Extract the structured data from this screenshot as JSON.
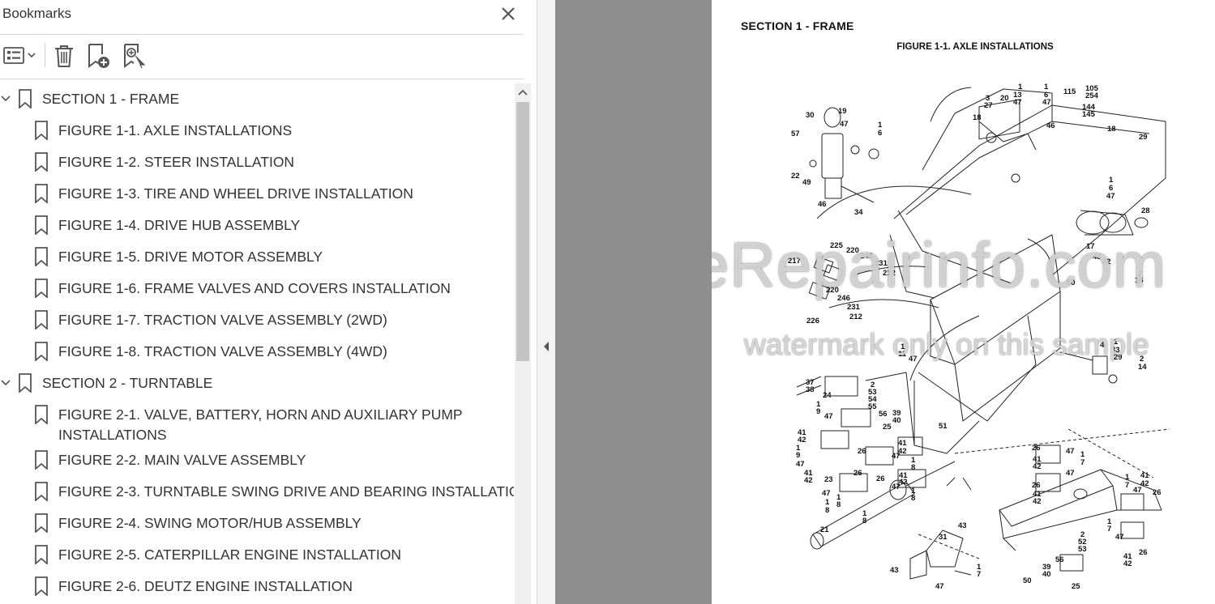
{
  "bookmarks_panel": {
    "title": "Bookmarks",
    "close_icon": "close-icon",
    "toolbar": {
      "options_icon": "list-options-icon",
      "delete_icon": "trash-icon",
      "new_bookmark_icon": "add-bookmark-icon",
      "find_bookmark_icon": "find-current-bookmark-icon"
    },
    "items": [
      {
        "label": "SECTION 1 - FRAME",
        "level": 0,
        "expanded": true
      },
      {
        "label": "FIGURE 1-1. AXLE INSTALLATIONS",
        "level": 1
      },
      {
        "label": "FIGURE 1-2. STEER INSTALLATION",
        "level": 1
      },
      {
        "label": "FIGURE 1-3. TIRE AND WHEEL DRIVE INSTALLATION",
        "level": 1
      },
      {
        "label": "FIGURE 1-4. DRIVE HUB ASSEMBLY",
        "level": 1
      },
      {
        "label": "FIGURE 1-5. DRIVE MOTOR ASSEMBLY",
        "level": 1
      },
      {
        "label": "FIGURE 1-6. FRAME VALVES AND COVERS INSTALLATION",
        "level": 1
      },
      {
        "label": "FIGURE 1-7. TRACTION VALVE ASSEMBLY (2WD)",
        "level": 1
      },
      {
        "label": "FIGURE 1-8. TRACTION VALVE ASSEMBLY (4WD)",
        "level": 1
      },
      {
        "label": "SECTION 2 - TURNTABLE",
        "level": 0,
        "expanded": true
      },
      {
        "label": "FIGURE 2-1. VALVE, BATTERY, HORN AND AUXILIARY PUMP INSTALLATIONS",
        "level": 1
      },
      {
        "label": "FIGURE 2-2. MAIN VALVE ASSEMBLY",
        "level": 1
      },
      {
        "label": "FIGURE 2-3. TURNTABLE SWING DRIVE AND BEARING INSTALLATION",
        "level": 1
      },
      {
        "label": "FIGURE 2-4. SWING MOTOR/HUB ASSEMBLY",
        "level": 1
      },
      {
        "label": "FIGURE 2-5. CATERPILLAR ENGINE INSTALLATION",
        "level": 1
      },
      {
        "label": "FIGURE 2-6. DEUTZ ENGINE INSTALLATION",
        "level": 1
      }
    ]
  },
  "document": {
    "section_title": "SECTION 1 - FRAME",
    "figure_title": "FIGURE 1-1. AXLE INSTALLATIONS",
    "watermark_main": "eRepairinfo.com",
    "watermark_sub": "watermark only on this sample",
    "callouts": [
      "1",
      "13",
      "47",
      "1",
      "6",
      "47",
      "115",
      "105",
      "254",
      "3",
      "27",
      "20",
      "144",
      "145",
      "30",
      "19",
      "47",
      "1",
      "6",
      "18",
      "46",
      "18",
      "29",
      "57",
      "22",
      "49",
      "46",
      "34",
      "1",
      "6",
      "47",
      "28",
      "17",
      "48",
      "32",
      "2",
      "16",
      "225",
      "220",
      "246",
      "217",
      "231",
      "212",
      "220",
      "246",
      "231",
      "212",
      "226",
      "50",
      "1",
      "11",
      "47",
      "4",
      "1",
      "33",
      "29",
      "2",
      "14",
      "37",
      "38",
      "24",
      "2",
      "53",
      "54",
      "55",
      "1",
      "9",
      "47",
      "56",
      "39",
      "40",
      "25",
      "51",
      "41",
      "42",
      "1",
      "9",
      "26",
      "41",
      "42",
      "47",
      "1",
      "8",
      "41",
      "42",
      "26",
      "47",
      "41",
      "42",
      "23",
      "1",
      "8",
      "47",
      "1",
      "8",
      "26",
      "47",
      "41",
      "42",
      "47",
      "1",
      "7",
      "1",
      "7",
      "47",
      "41",
      "42",
      "26",
      "26",
      "41",
      "42",
      "21",
      "1",
      "8",
      "31",
      "43",
      "2",
      "52",
      "53",
      "1",
      "7",
      "47",
      "56",
      "39",
      "40",
      "25",
      "43",
      "47",
      "1",
      "7",
      "50",
      "41",
      "42",
      "26"
    ]
  },
  "colors": {
    "panel_bg": "#ffffff",
    "gray_area": "#8e8e8e",
    "scroll_thumb": "#c3c3c3"
  }
}
